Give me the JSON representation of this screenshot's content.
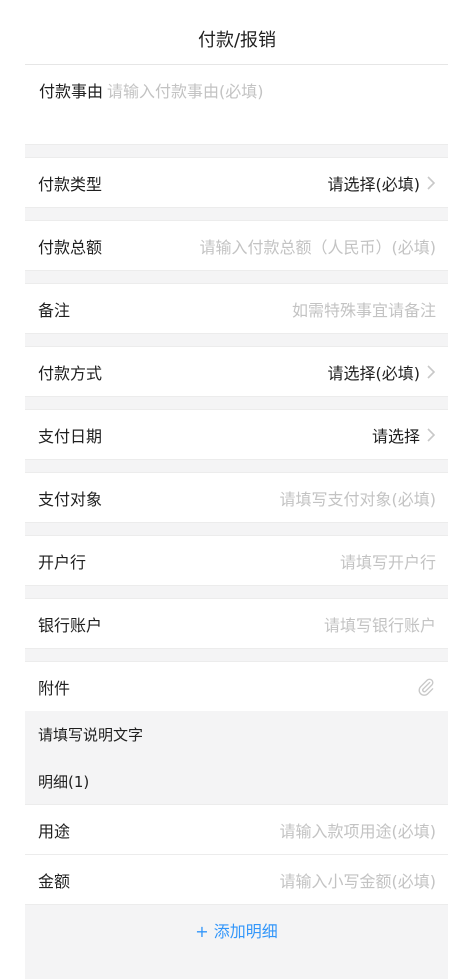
{
  "header": {
    "title": "付款/报销"
  },
  "reason": {
    "label": "付款事由",
    "placeholder": "请输入付款事由(必填)"
  },
  "fields": {
    "type": {
      "label": "付款类型",
      "value": "请选择(必填)"
    },
    "total": {
      "label": "付款总额",
      "placeholder": "请输入付款总额（人民币）(必填)"
    },
    "remark": {
      "label": "备注",
      "placeholder": "如需特殊事宜请备注"
    },
    "method": {
      "label": "付款方式",
      "value": "请选择(必填)"
    },
    "date": {
      "label": "支付日期",
      "value": "请选择"
    },
    "payee": {
      "label": "支付对象",
      "placeholder": "请填写支付对象(必填)"
    },
    "bank": {
      "label": "开户行",
      "placeholder": "请填写开户行"
    },
    "account": {
      "label": "银行账户",
      "placeholder": "请填写银行账户"
    },
    "attachment": {
      "label": "附件",
      "icon": "paperclip-icon"
    }
  },
  "note": {
    "text": "请填写说明文字"
  },
  "detail": {
    "title": "明细(1)",
    "purpose": {
      "label": "用途",
      "placeholder": "请输入款项用途(必填)"
    },
    "amount": {
      "label": "金额",
      "placeholder": "请输入小写金额(必填)"
    },
    "add_label": "+ 添加明细"
  },
  "colors": {
    "accent": "#3296fa",
    "placeholder": "#c3c3c3",
    "section_bg": "#f4f4f5"
  }
}
